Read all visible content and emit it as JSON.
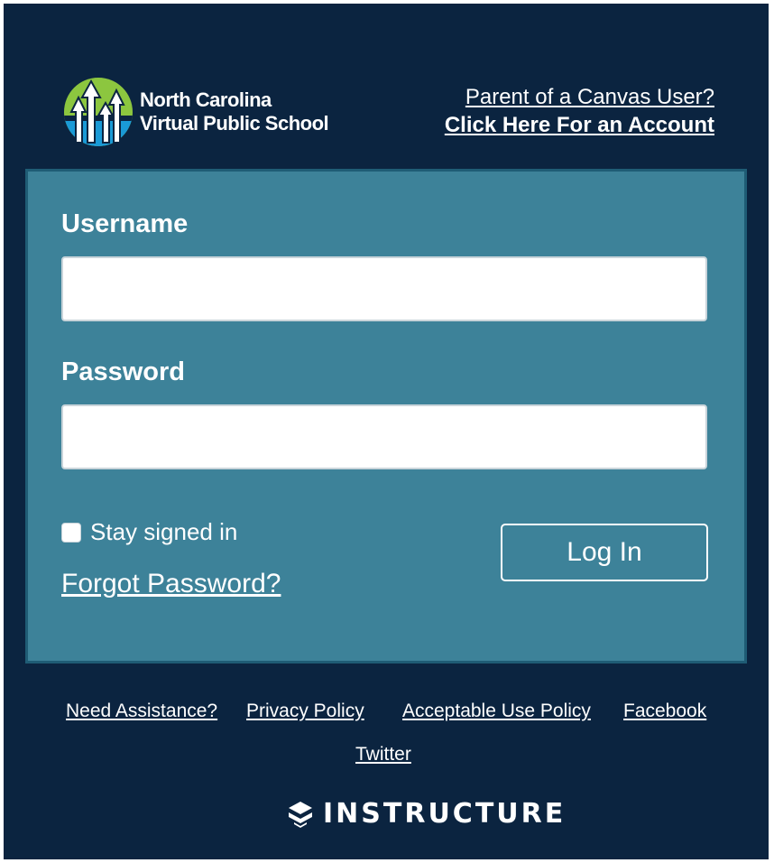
{
  "header": {
    "logo_line1": "North Carolina",
    "logo_line2": "Virtual Public School",
    "parent_question": "Parent of a Canvas User?",
    "parent_link": "Click Here For an Account"
  },
  "form": {
    "username_label": "Username",
    "username_value": "",
    "password_label": "Password",
    "password_value": "",
    "stay_signed_in": "Stay signed in",
    "forgot_password": "Forgot Password?",
    "login_button": "Log In"
  },
  "footer": {
    "links": [
      "Need Assistance?",
      "Privacy Policy",
      "Acceptable Use Policy",
      "Facebook",
      "Twitter"
    ],
    "brand": "INSTRUCTURE"
  },
  "colors": {
    "background": "#0b2440",
    "panel": "#3d8299",
    "panel_border": "#1f5c75"
  }
}
